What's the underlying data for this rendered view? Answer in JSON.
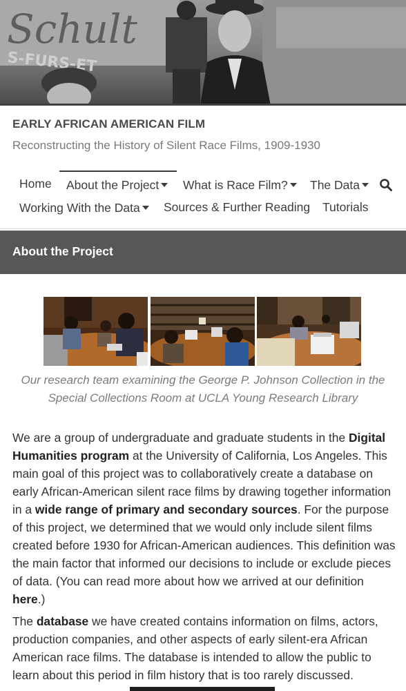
{
  "hero": {
    "sign_text": "Schult",
    "banner_text": "S-FURS-ET"
  },
  "site": {
    "title": "EARLY AFRICAN AMERICAN FILM",
    "tagline": "Reconstructing the History of Silent Race Films, 1909-1930"
  },
  "nav": {
    "items": [
      {
        "label": "Home"
      },
      {
        "label": "About the Project",
        "has_dropdown": true,
        "active": true
      },
      {
        "label": "What is Race Film?",
        "has_dropdown": true
      },
      {
        "label": "The Data",
        "has_dropdown": true
      },
      {
        "label": "Working With the Data",
        "has_dropdown": true
      },
      {
        "label": "Sources & Further Reading"
      },
      {
        "label": "Tutorials"
      }
    ],
    "search_icon": "search-icon"
  },
  "page": {
    "title": "About the Project"
  },
  "gallery": {
    "caption_line1": "Our research team examining the George P. Johnson Collection in the",
    "caption_line2": "Special Collections Room at UCLA Young Research Library"
  },
  "content": {
    "p1": {
      "t1": "We are a group of undergraduate and graduate students in the ",
      "b1": "Digital Humanities program",
      "t2": " at the University of California, Los Angeles. This main goal of this project was to collaboratively create a database on early African-American silent race films by drawing together information in a ",
      "b2": "wide range of primary and secondary sources",
      "t3": ". For the purpose of this project, we determined that we would only include silent films created before 1930 for African-American audiences. This definition was the main factor that informed our decisions to include or exclude pieces of data. (You can read more about how we arrived at our definition ",
      "link": "here",
      "t4": ".)"
    },
    "p2": {
      "t1": "The ",
      "b1": "database",
      "t2": " we have created contains information on films, actors, production companies, and other aspects of early silent-era African American race films. The database is intended to allow the public to learn about this period in film history that is too rarely discussed."
    }
  },
  "colors": {
    "title_band": "#575757",
    "text": "#333333",
    "muted": "#7a7a7a"
  }
}
